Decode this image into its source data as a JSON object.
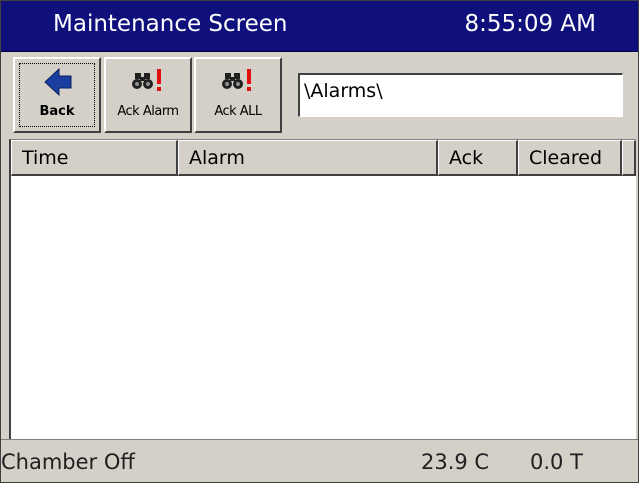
{
  "window": {
    "title": "Maintenance Screen",
    "clock": "8:55:09 AM"
  },
  "toolbar": {
    "back_label": "Back",
    "ack_alarm_label": "Ack Alarm",
    "ack_all_label": "Ack ALL",
    "path_value": "\\Alarms\\"
  },
  "grid": {
    "columns": [
      "Time",
      "Alarm",
      "Ack",
      "Cleared"
    ],
    "rows": []
  },
  "status": {
    "chamber": "Chamber Off",
    "temperature": "23.9 C",
    "humidity": "0.0 T"
  },
  "colors": {
    "titlebar": "#10107c",
    "face": "#d4d0c8",
    "back_arrow": "#1a3fa0",
    "alarm_mark": "#e01010"
  },
  "icons": {
    "back": "left-arrow-icon",
    "ack_alarm": "binoculars-exclamation-icon",
    "ack_all": "binoculars-exclamation-icon"
  }
}
